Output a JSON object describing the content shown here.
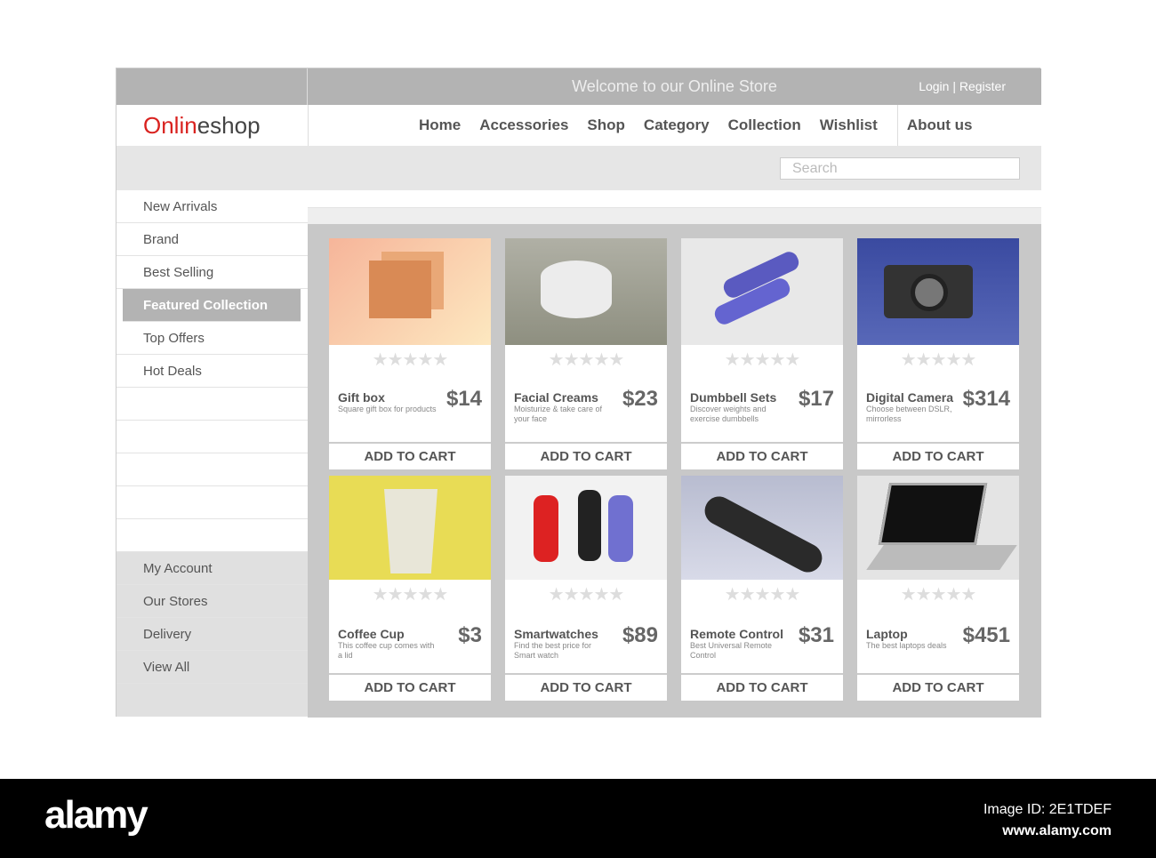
{
  "header": {
    "welcome": "Welcome to our Online Store",
    "login": "Login | Register",
    "logo_part1": "Onlin",
    "logo_part2": "e",
    "logo_part3": "shop"
  },
  "nav": [
    "Home",
    "Accessories",
    "Shop",
    "Category",
    "Collection",
    "Wishlist",
    "About us"
  ],
  "search": {
    "placeholder": "Search"
  },
  "sidebar": {
    "items": [
      "New Arrivals",
      "Brand",
      "Best Selling",
      "Featured Collection",
      "Top Offers",
      "Hot Deals"
    ],
    "active": "Featured Collection",
    "account_items": [
      "My Account",
      "Our Stores",
      "Delivery",
      "View All"
    ]
  },
  "products": [
    {
      "name": "Gift box",
      "desc": "Square gift box for products",
      "price": "$14",
      "rating": 0,
      "cart": "ADD TO CART"
    },
    {
      "name": "Facial Creams",
      "desc": "Moisturize & take care of your face",
      "price": "$23",
      "rating": 0,
      "cart": "ADD TO CART"
    },
    {
      "name": "Dumbbell Sets",
      "desc": "Discover weights and exercise dumbbells",
      "price": "$17",
      "rating": 0,
      "cart": "ADD TO CART"
    },
    {
      "name": "Digital Camera",
      "desc": "Choose between DSLR, mirrorless",
      "price": "$314",
      "rating": 0,
      "cart": "ADD TO CART"
    },
    {
      "name": "Coffee Cup",
      "desc": "This coffee cup comes with a lid",
      "price": "$3",
      "rating": 0,
      "cart": "ADD TO CART"
    },
    {
      "name": "Smartwatches",
      "desc": "Find the best price for Smart watch",
      "price": "$89",
      "rating": 0,
      "cart": "ADD TO CART"
    },
    {
      "name": "Remote Control",
      "desc": "Best Universal Remote Control",
      "price": "$31",
      "rating": 0,
      "cart": "ADD TO CART"
    },
    {
      "name": "Laptop",
      "desc": "The best laptops deals",
      "price": "$451",
      "rating": 0,
      "cart": "ADD TO CART"
    }
  ],
  "watermark": {
    "brand": "alamy",
    "image_id": "Image ID: 2E1TDEF",
    "url": "www.alamy.com"
  },
  "colors": {
    "accent": "#d9221f",
    "bar": "#b3b3b3"
  }
}
